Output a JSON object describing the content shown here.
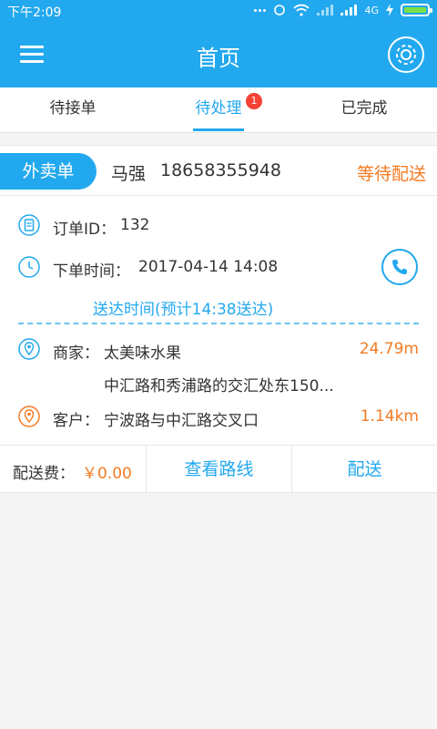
{
  "status_bar": {
    "time": "下午2:09",
    "network_label": "4G"
  },
  "header": {
    "title": "首页",
    "menu_icon": "menu-icon",
    "settings_icon": "settings-icon"
  },
  "tabs": [
    {
      "label": "待接单",
      "active": false
    },
    {
      "label": "待处理",
      "active": true,
      "badge": "1"
    },
    {
      "label": "已完成",
      "active": false
    }
  ],
  "order": {
    "type": "外卖单",
    "customer_name": "马强",
    "customer_phone": "18658355948",
    "status": "等待配送",
    "id_label": "订单ID：",
    "id_value": "132",
    "time_label": "下单时间：",
    "time_value": "2017-04-14 14:08",
    "delivery_eta": "送达时间(预计14:38送达)",
    "merchant_label": "商家：",
    "merchant_name": "太美味水果",
    "merchant_distance": "24.79m",
    "merchant_address": "中汇路和秀浦路的交汇处东150...",
    "client_label": "客户：",
    "client_address": "宁波路与中汇路交叉口",
    "client_distance": "1.14km",
    "fee_label": "配送费：",
    "fee_value": "￥0.00",
    "view_route_label": "查看路线",
    "deliver_label": "配送"
  },
  "colors": {
    "primary": "#22a8ee",
    "accent": "#f57a22",
    "badge": "#f44336"
  }
}
